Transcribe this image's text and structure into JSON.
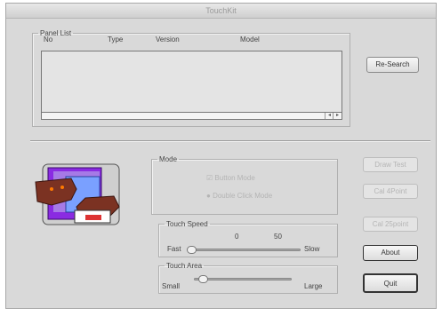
{
  "window": {
    "title": "TouchKit"
  },
  "panel_list": {
    "legend": "Panel List",
    "columns": [
      "No",
      "Type",
      "Version",
      "Model"
    ],
    "scroll_left": "◂",
    "scroll_right": "▸"
  },
  "buttons": {
    "research": "Re-Search",
    "draw_test": "Draw Test",
    "cal_4point": "Cal 4Point",
    "cal_25point": "Cal 25point",
    "about": "About",
    "quit": "Quit"
  },
  "mode": {
    "legend": "Mode",
    "options": [
      "Button Mode",
      "Double Click Mode"
    ]
  },
  "touch_speed": {
    "legend": "Touch Speed",
    "tick_values": [
      "0",
      "50"
    ],
    "min_label": "Fast",
    "max_label": "Slow",
    "value": 0.0
  },
  "touch_area": {
    "legend": "Touch Area",
    "min_label": "Small",
    "max_label": "Large",
    "value": 0.05
  },
  "colors": {
    "window_bg": "#d9d9d9",
    "logo_purple": "#8a2be2",
    "logo_blue": "#7aa0ff",
    "logo_brown": "#7b3222"
  }
}
